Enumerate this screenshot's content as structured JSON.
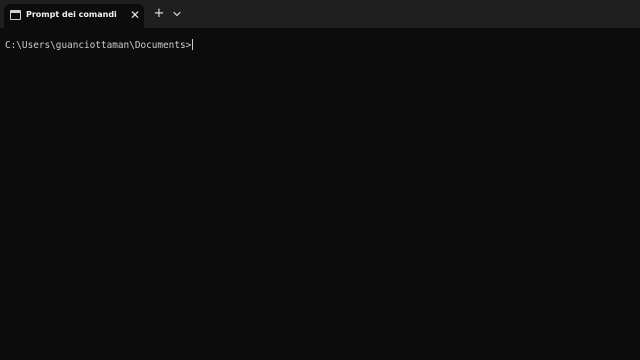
{
  "window": {
    "tabs": [
      {
        "title": "Prompt dei comandi",
        "icon": "terminal-icon",
        "close_glyph": "✕"
      }
    ],
    "new_tab_glyph": "+",
    "dropdown_icon": "chevron-down-icon"
  },
  "terminal": {
    "prompt": "C:\\Users\\guanciottaman\\Documents>"
  },
  "colors": {
    "titlebar": "#1f1f1f",
    "background": "#0c0c0c",
    "text": "#cccccc"
  }
}
